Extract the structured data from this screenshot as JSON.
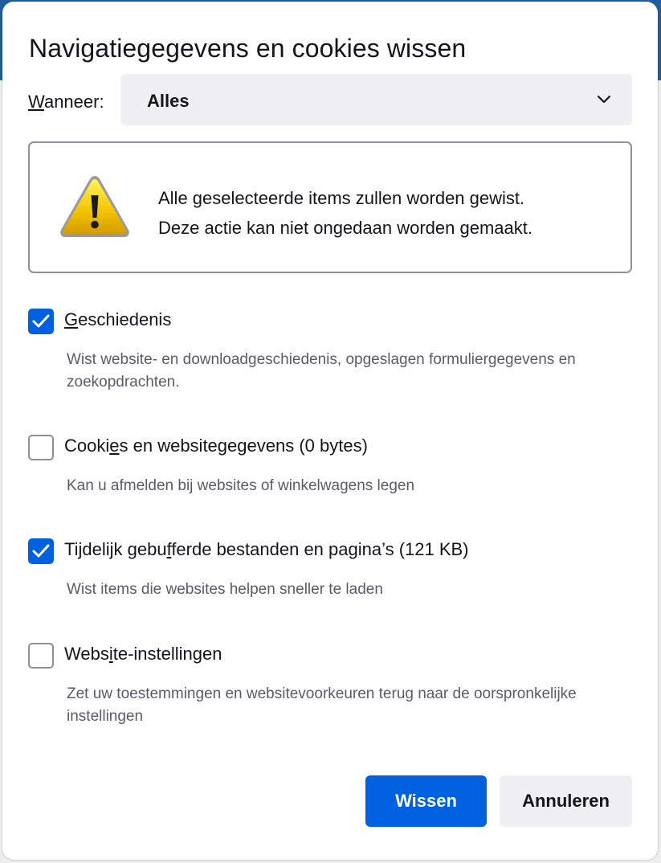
{
  "dialog": {
    "title": "Navigatiegegevens en cookies wissen"
  },
  "when": {
    "label_first": "W",
    "label_rest": "anneer:",
    "selected": "Alles"
  },
  "warning": {
    "line1": "Alle geselecteerde items zullen worden gewist.",
    "line2": "Deze actie kan niet ongedaan worden gemaakt."
  },
  "options": [
    {
      "checked": true,
      "label_pre": "",
      "label_u": "G",
      "label_post": "eschiedenis",
      "desc": "Wist website- en downloadgeschiedenis, opgeslagen formuliergegevens en zoekopdrachten."
    },
    {
      "checked": false,
      "label_pre": "Cooki",
      "label_u": "e",
      "label_post": "s en websitegegevens (0 bytes)",
      "desc": "Kan u afmelden bij websites of winkelwagens legen"
    },
    {
      "checked": true,
      "label_pre": "Tijdelijk gebu",
      "label_u": "f",
      "label_post": "ferde bestanden en pagina’s (121 KB)",
      "desc": "Wist items die websites helpen sneller te laden"
    },
    {
      "checked": false,
      "label_pre": "Webs",
      "label_u": "i",
      "label_post": "te-instellingen",
      "desc": "Zet uw toestemmingen en websitevoorkeuren terug naar de oorspronkelijke instellingen"
    }
  ],
  "buttons": {
    "clear": "Wissen",
    "cancel": "Annuleren"
  },
  "colors": {
    "accent": "#0061e0",
    "text": "#15141a",
    "secondary_text": "#5b5b66",
    "button_secondary": "#f0f0f4"
  }
}
